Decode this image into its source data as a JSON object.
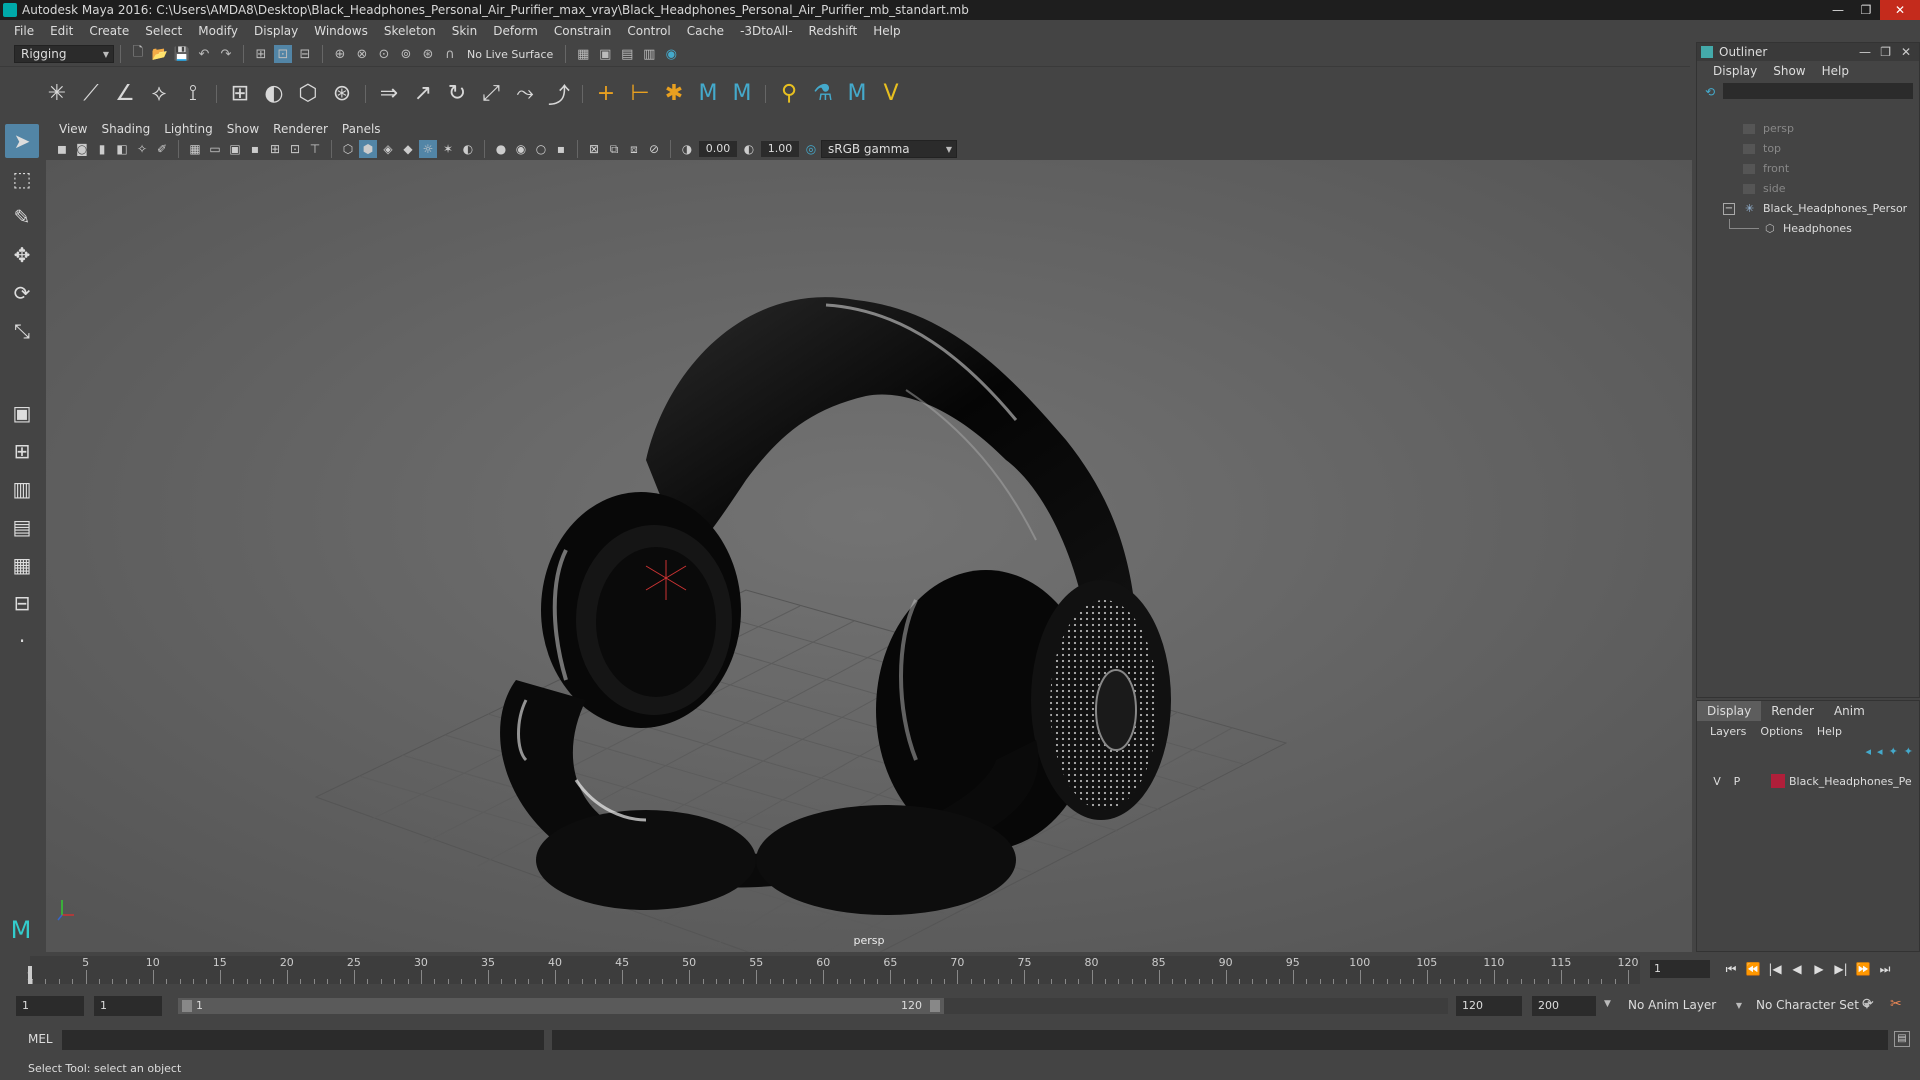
{
  "window": {
    "title": "Autodesk Maya 2016: C:\\Users\\AMDA8\\Desktop\\Black_Headphones_Personal_Air_Purifier_max_vray\\Black_Headphones_Personal_Air_Purifier_mb_standart.mb",
    "minimize": "—",
    "maximize": "❐",
    "close": "✕"
  },
  "menubar": [
    "File",
    "Edit",
    "Create",
    "Select",
    "Modify",
    "Display",
    "Windows",
    "Skeleton",
    "Skin",
    "Deform",
    "Constrain",
    "Control",
    "Cache",
    "-3DtoAll-",
    "Redshift",
    "Help"
  ],
  "statusline": {
    "menuset": "Rigging",
    "live_surface": "No Live Surface"
  },
  "viewport": {
    "menu": [
      "View",
      "Shading",
      "Lighting",
      "Show",
      "Renderer",
      "Panels"
    ],
    "exposure": "0.00",
    "gamma": "1.00",
    "color_space": "sRGB gamma",
    "camera_label": "persp"
  },
  "outliner": {
    "title": "Outliner",
    "menu": [
      "Display",
      "Show",
      "Help"
    ],
    "items": [
      {
        "label": "persp",
        "kind": "camera"
      },
      {
        "label": "top",
        "kind": "camera"
      },
      {
        "label": "front",
        "kind": "camera"
      },
      {
        "label": "side",
        "kind": "camera"
      },
      {
        "label": "Black_Headphones_Personal",
        "kind": "group"
      },
      {
        "label": "Headphones",
        "kind": "mesh"
      }
    ],
    "collapse_glyph": "−"
  },
  "layers": {
    "tabs": [
      "Display",
      "Render",
      "Anim"
    ],
    "active_tab": "Display",
    "menu": [
      "Layers",
      "Options",
      "Help"
    ],
    "row": {
      "v": "V",
      "p": "P",
      "name": "Black_Headphones_Pe",
      "color": "#b01f3a"
    }
  },
  "timeslider": {
    "ticks": [
      "5",
      "10",
      "15",
      "20",
      "25",
      "30",
      "35",
      "40",
      "45",
      "50",
      "55",
      "60",
      "65",
      "70",
      "75",
      "80",
      "85",
      "90",
      "95",
      "100",
      "105",
      "110",
      "115",
      "120"
    ],
    "start_tick": "1",
    "current_frame": "1",
    "playback": [
      "⏮",
      "⏪",
      "|◀",
      "◀",
      "▶",
      "▶|",
      "⏩",
      "⏭"
    ]
  },
  "rangeslider": {
    "start": "1",
    "range_start_field": "1",
    "range_bar_start": "1",
    "range_bar_end": "120",
    "range_end_field": "120",
    "end": "200",
    "anim_layer": "No Anim Layer",
    "char_set": "No Character Set"
  },
  "cmdline": {
    "label": "MEL"
  },
  "helpline": {
    "text": "Select Tool: select an object"
  }
}
